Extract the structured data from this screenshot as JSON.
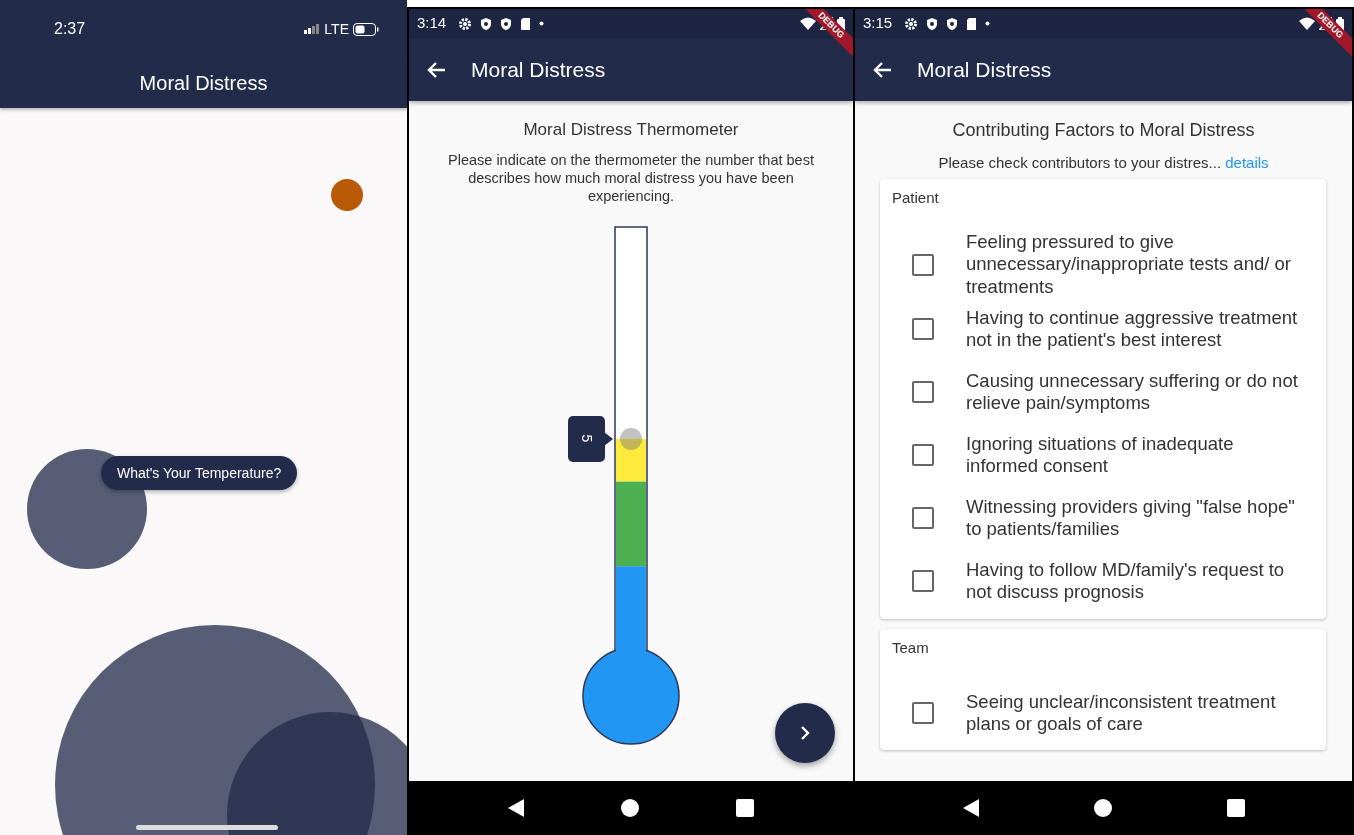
{
  "screens": [
    {
      "kind": "splash",
      "status_bar": {
        "time": "2:37",
        "network": "LTE"
      },
      "app_bar": {
        "title": "Moral Distress",
        "back": false
      },
      "start_button": "What's Your Temperature?"
    },
    {
      "kind": "thermometer",
      "status_bar": {
        "time": "3:14"
      },
      "debug_banner": "DEBUG",
      "app_bar": {
        "title": "Moral Distress",
        "back": true
      },
      "heading": "Moral Distress Thermometer",
      "instructions": "Please indicate on the thermometer the number that best describes how much moral distress you have been experiencing.",
      "thermometer": {
        "level": 0.5,
        "value": "5"
      }
    },
    {
      "kind": "checklist",
      "status_bar": {
        "time": "3:15"
      },
      "debug_banner": "DEBUG",
      "app_bar": {
        "title": "Moral Distress",
        "back": true
      },
      "heading": "Contributing Factors to Moral Distress",
      "instructions": "Please check contributors to your distres...",
      "details_link": "details",
      "sections": [
        {
          "title": "Patient",
          "items": [
            {
              "label": "Feeling pressured to give unnecessary/inappropriate tests and/ or treatments",
              "checked": false
            },
            {
              "label": "Having to continue aggressive treatment not in the patient's best interest",
              "checked": false
            },
            {
              "label": "Causing unnecessary suffering or do not relieve pain/symptoms",
              "checked": false
            },
            {
              "label": "Ignoring situations of inadequate informed consent",
              "checked": false
            },
            {
              "label": "Witnessing providers giving \"false hope\" to patients/families",
              "checked": false
            },
            {
              "label": "Having to follow MD/family's request to not discuss prognosis",
              "checked": false
            }
          ]
        },
        {
          "title": "Team",
          "items": [
            {
              "label": "Seeing unclear/inconsistent treatment plans or goals of care",
              "checked": false
            }
          ]
        }
      ]
    }
  ]
}
